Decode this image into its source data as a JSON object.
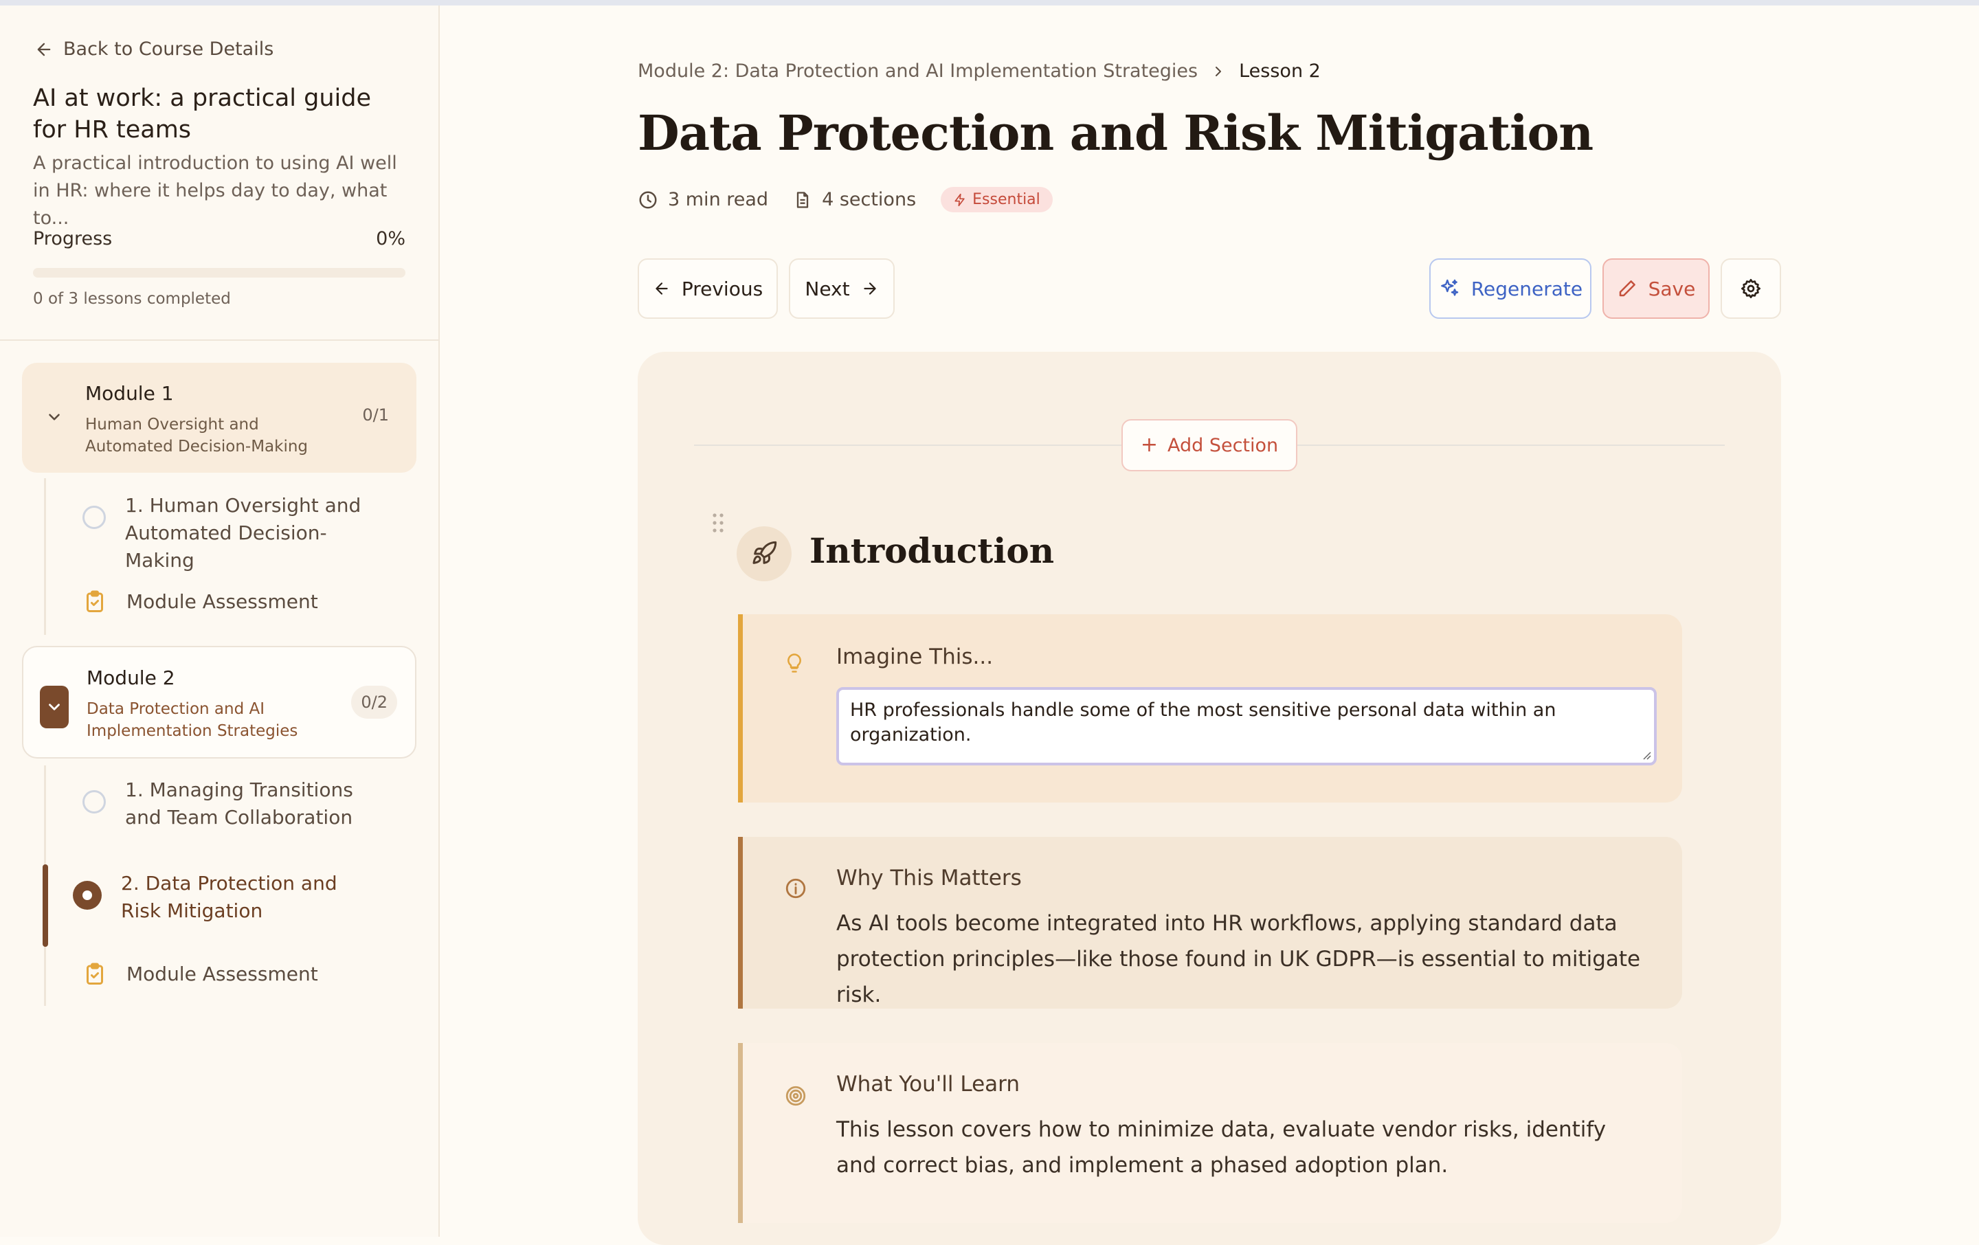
{
  "sidebar": {
    "back_label": "Back to Course Details",
    "course_title": "AI at work: a practical guide for HR teams",
    "course_desc": "A practical introduction to using AI well in HR: where it helps day to day, what to...",
    "progress_label": "Progress",
    "progress_pct": "0%",
    "progress_value": 0,
    "progress_sub": "0 of 3 lessons completed",
    "modules": [
      {
        "title": "Module 1",
        "subtitle": "Human Oversight and Automated Decision-Making",
        "count": "0/1",
        "lessons": [
          {
            "label": "1. Human Oversight and Automated Decision-Making"
          },
          {
            "label": "Module Assessment"
          }
        ]
      },
      {
        "title": "Module 2",
        "subtitle": "Data Protection and AI Implementation Strategies",
        "count": "0/2",
        "lessons": [
          {
            "label": "1. Managing Transitions and Team Collaboration"
          },
          {
            "label": "2. Data Protection and Risk Mitigation"
          },
          {
            "label": "Module Assessment"
          }
        ]
      }
    ]
  },
  "header": {
    "breadcrumb_module": "Module 2: Data Protection and AI Implementation Strategies",
    "breadcrumb_lesson": "Lesson 2",
    "title": "Data Protection and Risk Mitigation",
    "read_time": "3 min read",
    "sections": "4 sections",
    "badge": "Essential"
  },
  "toolbar": {
    "previous": "Previous",
    "next": "Next",
    "regenerate": "Regenerate",
    "save": "Save"
  },
  "content": {
    "add_section": "Add Section",
    "section_title": "Introduction",
    "callouts": [
      {
        "heading": "Imagine This...",
        "body": "HR professionals handle some of the most sensitive personal data within an organization."
      },
      {
        "heading": "Why This Matters",
        "body": "As AI tools become integrated into HR workflows, applying standard data protection principles—like those found in UK GDPR—is essential to mitigate risk."
      },
      {
        "heading": "What You'll Learn",
        "body": "This lesson covers how to minimize data, evaluate vendor risks, identify and correct bias, and implement a phased adoption plan."
      }
    ]
  },
  "colors": {
    "accent_brown": "#7a4a2c",
    "regenerate_blue": "#3e63c4",
    "save_red": "#c4503c",
    "badge_bg": "#fbe1de"
  }
}
